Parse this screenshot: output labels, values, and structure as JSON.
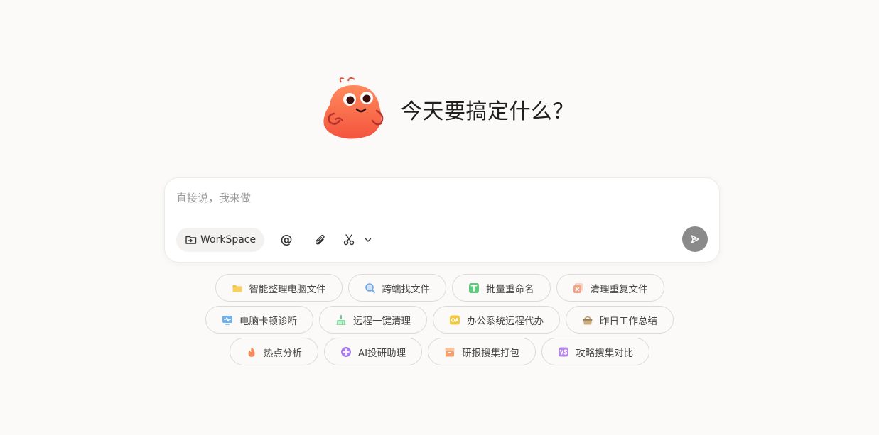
{
  "hero": {
    "title": "今天要搞定什么？"
  },
  "composer": {
    "placeholder": "直接说，我来做",
    "workspace_label": "WorkSpace",
    "at_symbol": "@"
  },
  "suggestions": {
    "row1": [
      {
        "label": "智能整理电脑文件",
        "icon": "folder-icon",
        "color": "#f5c242"
      },
      {
        "label": "跨端找文件",
        "icon": "magnifier-icon",
        "color": "#6fa8e8"
      },
      {
        "label": "批量重命名",
        "icon": "rename-t-icon",
        "color": "#5fc97e"
      },
      {
        "label": "清理重复文件",
        "icon": "duplicate-clean-icon",
        "color": "#f0a58a"
      }
    ],
    "row2": [
      {
        "label": "电脑卡顿诊断",
        "icon": "monitor-pulse-icon",
        "color": "#6fb0ee"
      },
      {
        "label": "远程一键清理",
        "icon": "broom-icon",
        "color": "#67c987"
      },
      {
        "label": "办公系统远程代办",
        "icon": "oa-icon",
        "color": "#f2c93e"
      },
      {
        "label": "昨日工作总结",
        "icon": "basket-icon",
        "color": "#b99a6c"
      }
    ],
    "row3": [
      {
        "label": "热点分析",
        "icon": "flame-icon",
        "color": "#f58a5b"
      },
      {
        "label": "AI投研助理",
        "icon": "ai-spark-icon",
        "color": "#a77ee8"
      },
      {
        "label": "研报搜集打包",
        "icon": "box-icon",
        "color": "#f5a06a"
      },
      {
        "label": "攻略搜集对比",
        "icon": "vs-icon",
        "color": "#b58ae6"
      }
    ]
  }
}
